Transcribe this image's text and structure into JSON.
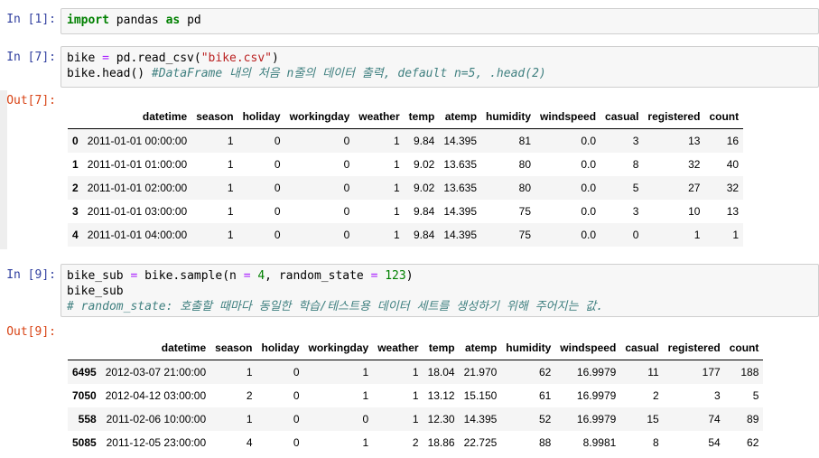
{
  "cells": [
    {
      "prompt": "In [1]:",
      "lines": [
        [
          {
            "t": "import",
            "c": "kw"
          },
          {
            "t": " pandas ",
            "c": ""
          },
          {
            "t": "as",
            "c": "kw"
          },
          {
            "t": " pd",
            "c": ""
          }
        ]
      ]
    },
    {
      "prompt": "In [7]:",
      "lines": [
        [
          {
            "t": "bike ",
            "c": ""
          },
          {
            "t": "=",
            "c": "op"
          },
          {
            "t": " pd.read_csv(",
            "c": ""
          },
          {
            "t": "\"bike.csv\"",
            "c": "str"
          },
          {
            "t": ")",
            "c": ""
          }
        ],
        [
          {
            "t": "bike.head() ",
            "c": ""
          },
          {
            "t": "#DataFrame 내의 처음 n줄의 데이터 출력, default n=5, .head(2)",
            "c": "cm"
          }
        ]
      ]
    },
    {
      "prompt": "In [9]:",
      "lines": [
        [
          {
            "t": "bike_sub ",
            "c": ""
          },
          {
            "t": "=",
            "c": "op"
          },
          {
            "t": " bike.sample(n ",
            "c": ""
          },
          {
            "t": "=",
            "c": "op"
          },
          {
            "t": " ",
            "c": ""
          },
          {
            "t": "4",
            "c": "num"
          },
          {
            "t": ", random_state ",
            "c": ""
          },
          {
            "t": "=",
            "c": "op"
          },
          {
            "t": " ",
            "c": ""
          },
          {
            "t": "123",
            "c": "num"
          },
          {
            "t": ")",
            "c": ""
          }
        ],
        [
          {
            "t": "bike_sub",
            "c": ""
          }
        ],
        [
          {
            "t": "# random_state: 호출할 때마다 동일한 학습/테스트용 데이터 세트를 생성하기 위해 주어지는 값.",
            "c": "cm"
          }
        ]
      ]
    }
  ],
  "outputs": [
    {
      "prompt": "Out[7]:",
      "columns": [
        "",
        "datetime",
        "season",
        "holiday",
        "workingday",
        "weather",
        "temp",
        "atemp",
        "humidity",
        "windspeed",
        "casual",
        "registered",
        "count"
      ],
      "rows": [
        [
          "0",
          "2011-01-01 00:00:00",
          "1",
          "0",
          "0",
          "1",
          "9.84",
          "14.395",
          "81",
          "0.0",
          "3",
          "13",
          "16"
        ],
        [
          "1",
          "2011-01-01 01:00:00",
          "1",
          "0",
          "0",
          "1",
          "9.02",
          "13.635",
          "80",
          "0.0",
          "8",
          "32",
          "40"
        ],
        [
          "2",
          "2011-01-01 02:00:00",
          "1",
          "0",
          "0",
          "1",
          "9.02",
          "13.635",
          "80",
          "0.0",
          "5",
          "27",
          "32"
        ],
        [
          "3",
          "2011-01-01 03:00:00",
          "1",
          "0",
          "0",
          "1",
          "9.84",
          "14.395",
          "75",
          "0.0",
          "3",
          "10",
          "13"
        ],
        [
          "4",
          "2011-01-01 04:00:00",
          "1",
          "0",
          "0",
          "1",
          "9.84",
          "14.395",
          "75",
          "0.0",
          "0",
          "1",
          "1"
        ]
      ]
    },
    {
      "prompt": "Out[9]:",
      "columns": [
        "",
        "datetime",
        "season",
        "holiday",
        "workingday",
        "weather",
        "temp",
        "atemp",
        "humidity",
        "windspeed",
        "casual",
        "registered",
        "count"
      ],
      "rows": [
        [
          "6495",
          "2012-03-07 21:00:00",
          "1",
          "0",
          "1",
          "1",
          "18.04",
          "21.970",
          "62",
          "16.9979",
          "11",
          "177",
          "188"
        ],
        [
          "7050",
          "2012-04-12 03:00:00",
          "2",
          "0",
          "1",
          "1",
          "13.12",
          "15.150",
          "61",
          "16.9979",
          "2",
          "3",
          "5"
        ],
        [
          "558",
          "2011-02-06 10:00:00",
          "1",
          "0",
          "0",
          "1",
          "12.30",
          "14.395",
          "52",
          "16.9979",
          "15",
          "74",
          "89"
        ],
        [
          "5085",
          "2011-12-05 23:00:00",
          "4",
          "0",
          "1",
          "2",
          "18.86",
          "22.725",
          "88",
          "8.9981",
          "8",
          "54",
          "62"
        ]
      ]
    }
  ]
}
